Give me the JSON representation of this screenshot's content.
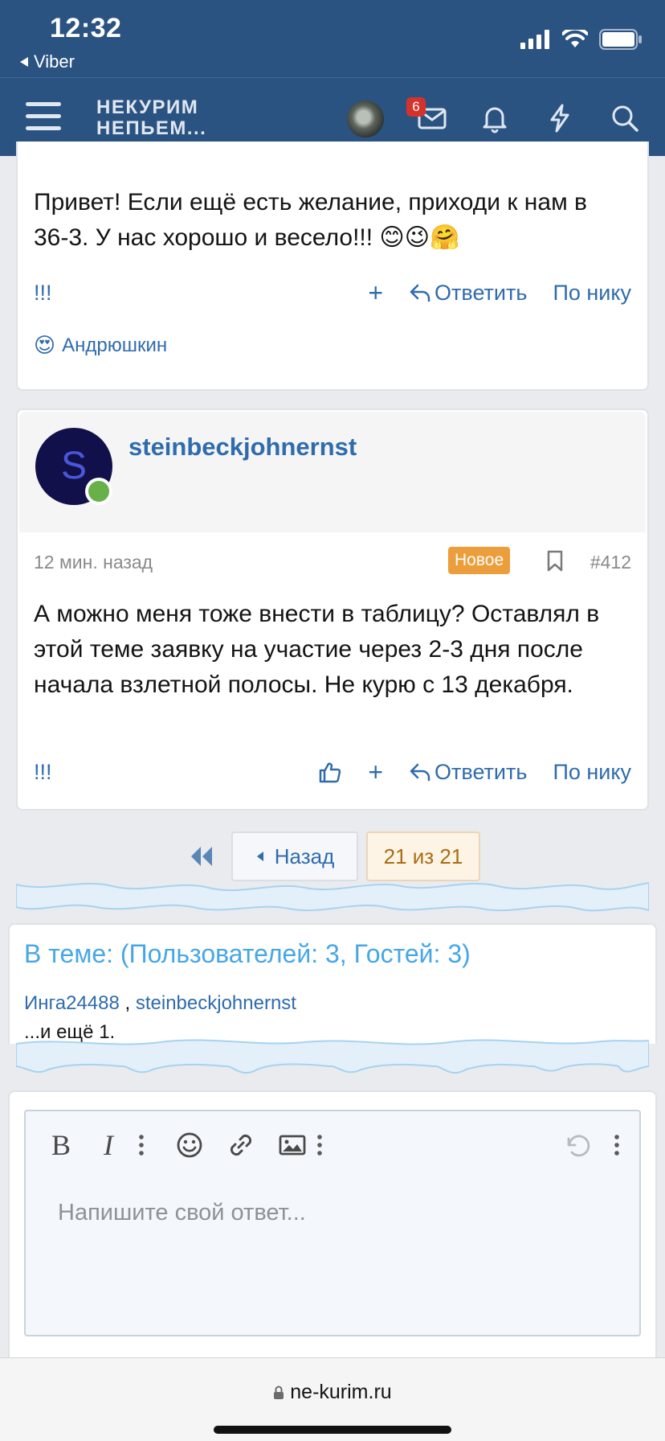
{
  "status_bar": {
    "time": "12:32",
    "back_app": "Viber"
  },
  "header": {
    "logo_line1": "НЕКУРИМ",
    "logo_line2": "НЕПЬЕМ...",
    "inbox_badge": "6",
    "icons": [
      "menu-icon",
      "user-avatar",
      "envelope-icon",
      "bell-icon",
      "lightning-icon",
      "search-icon"
    ]
  },
  "post1": {
    "text": "Привет! Если ещё есть желание, приходи к нам в 36-3. У нас хорошо и весело!!! 😊😉🤗",
    "bang": "!!!",
    "plus": "+",
    "reply": "Ответить",
    "by_nick": "По нику",
    "reaction_emoji": "😍",
    "reaction_user": "Андрюшкин"
  },
  "post2": {
    "avatar_letter": "S",
    "username": "steinbeckjohnernst",
    "time": "12 мин. назад",
    "new_badge": "Новое",
    "post_number": "#412",
    "text": "А можно меня тоже внести в таблицу? Оставлял в этой теме заявку на участие через 2-3 дня после начала взлетной полосы. Не курю с 13 декабря.",
    "bang": "!!!",
    "plus": "+",
    "reply": "Ответить",
    "by_nick": "По нику"
  },
  "pagination": {
    "back": "Назад",
    "current": "21 из 21"
  },
  "online": {
    "title": "В теме: (Пользователей: 3, Гостей: 3)",
    "user1": "Инга24488",
    "separator": " , ",
    "user2": "steinbeckjohnernst",
    "more": "...и ещё 1."
  },
  "reply_editor": {
    "placeholder": "Напишите свой ответ..."
  },
  "browser": {
    "url": "ne-kurim.ru"
  },
  "colors": {
    "header_bg": "#2b5382",
    "link": "#2f6bad",
    "new_badge": "#ec9e3c",
    "title_blue": "#47a7e6"
  }
}
